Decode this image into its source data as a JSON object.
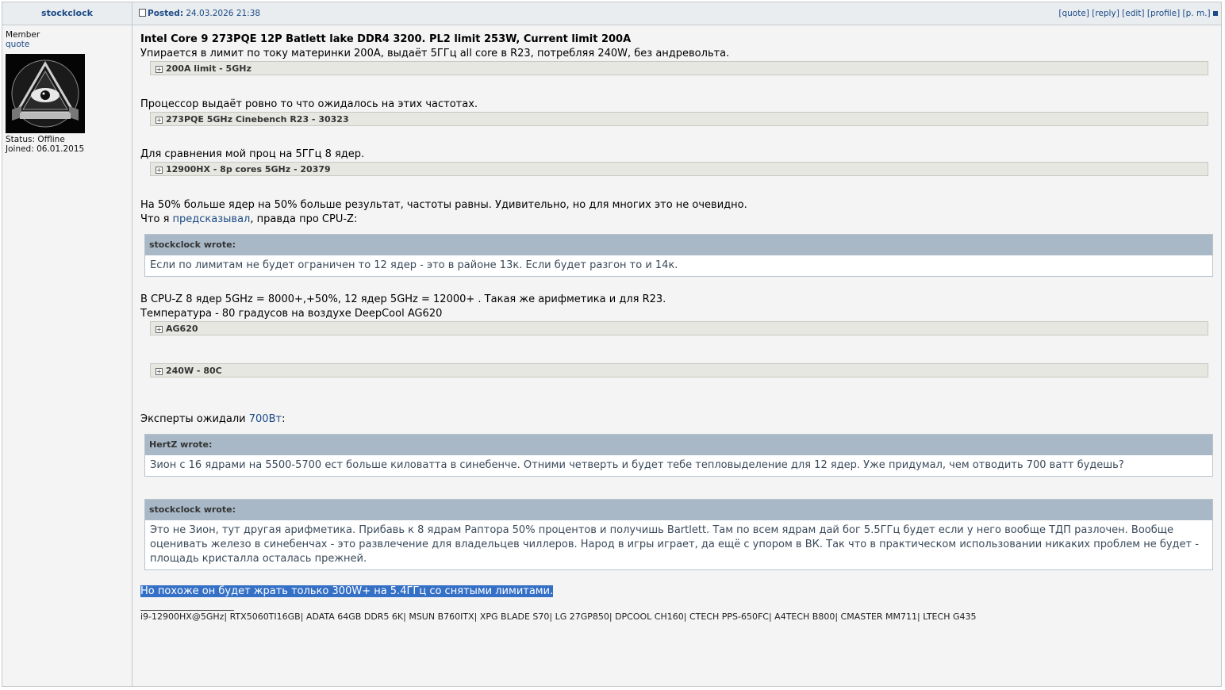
{
  "author": {
    "name": "stockclock",
    "rank": "Member",
    "quote_link": "quote",
    "status": "Status: Offline",
    "joined": "Joined: 06.01.2015"
  },
  "header": {
    "posted_label": "Posted:",
    "posted_date": "24.03.2026 21:38",
    "actions": [
      "[quote]",
      "[reply]",
      "[edit]",
      "[profile]",
      "[p. m.]"
    ]
  },
  "post": {
    "title": "Intel Core 9 273PQE 12P Batlett lake DDR4 3200. PL2 limit 253W, Current limit 200A",
    "p1": "Упирается в лимит по току материнки 200А, выдаёт 5ГГц all core в R23, потребляя 240W, без андревольта.",
    "spoiler1": "200A limit - 5GHz",
    "p2": "Процессор выдаёт ровно то что ожидалось на этих частотах.",
    "spoiler2": "273PQE 5GHz Cinebench R23 - 30323",
    "p3": "Для сравнения мой проц на 5ГГц 8 ядер.",
    "spoiler3": "12900HX - 8p cores 5GHz - 20379",
    "p4": "На 50% больше ядер на 50% больше результат, частоты равны. Удивительно, но для многих это не очевидно.",
    "p5_pre": "Что я ",
    "p5_link": "предсказывал",
    "p5_post": ", правда про CPU-Z:",
    "quote1_header": "stockclock wrote:",
    "quote1_body": "Если по лимитам не будет ограничен то 12 ядер - это в районе 13к. Если будет разгон то и 14к.",
    "p6": "В CPU-Z 8 ядер 5GHz = 8000+,+50%, 12 ядер 5GHz = 12000+ . Такая же арифметика и для R23.",
    "p7": "Температура - 80 градусов на воздухе DeepCool AG620",
    "spoiler4": "AG620",
    "spoiler5": "240W - 80C",
    "p8_pre": "Эксперты ожидали ",
    "p8_link": "700Вт",
    "p8_post": ":",
    "quote2_header": "HertZ wrote:",
    "quote2_body": "Зион с 16 ядрами на 5500-5700 ест больше киловатта в синебенче. Отними четверть и будет тебе тепловыделение для 12 ядер. Уже придумал, чем отводить 700 ватт будешь?",
    "quote3_header": "stockclock wrote:",
    "quote3_body": "Это не Зион, тут другая арифметика. Прибавь к 8 ядрам Раптора 50% процентов и получишь Bartlett. Там по всем ядрам дай бог 5.5ГГц будет если у него вообще ТДП разлочен. Вообще оценивать железо в синебенчах - это развлечение для владельцев чиллеров. Народ в игры играет, да ещё с упором в ВК. Так что в практическом использовании никаких проблем не будет - площадь кристалла осталась прежней.",
    "selected": "Но похоже он будет жрать только 300W+ на 5.4ГГц со снятыми лимитами."
  },
  "signature": "i9-12900HX@5GHz| RTX5060TI16GB| ADATA 64GB DDR5 6K| MSUN B760ITX| XPG BLADE S70| LG 27GP850| DPCOOL CH160| CTECH PPS-650FC| A4TECH B800| CMASTER MM711| LTECH G435"
}
